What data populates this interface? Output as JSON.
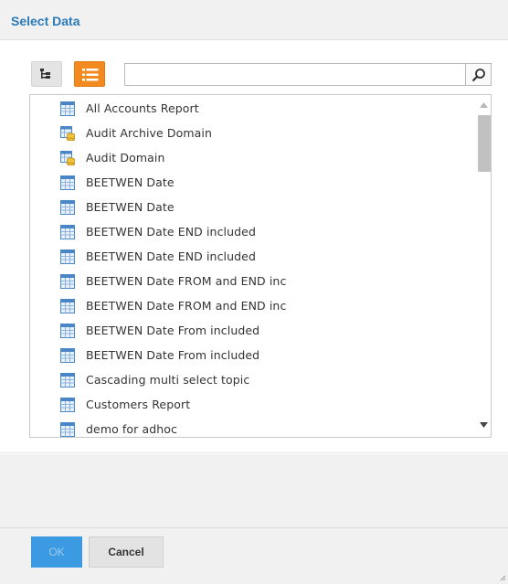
{
  "dialog": {
    "title": "Select Data"
  },
  "toolbar": {
    "tree_view_icon": "tree-view-icon",
    "list_view_icon": "list-view-icon",
    "search_placeholder": "",
    "search_value": "",
    "search_icon": "search-icon"
  },
  "items": [
    {
      "label": "All Accounts Report",
      "icon": "report-icon"
    },
    {
      "label": "Audit Archive Domain",
      "icon": "domain-icon"
    },
    {
      "label": "Audit Domain",
      "icon": "domain-icon"
    },
    {
      "label": "BEETWEN Date",
      "icon": "report-icon"
    },
    {
      "label": "BEETWEN Date",
      "icon": "report-icon"
    },
    {
      "label": "BEETWEN Date END included",
      "icon": "report-icon"
    },
    {
      "label": "BEETWEN Date END included",
      "icon": "report-icon"
    },
    {
      "label": "BEETWEN Date FROM and END inc",
      "icon": "report-icon"
    },
    {
      "label": "BEETWEN Date FROM and END inc",
      "icon": "report-icon"
    },
    {
      "label": "BEETWEN Date From included",
      "icon": "report-icon"
    },
    {
      "label": "BEETWEN Date From included",
      "icon": "report-icon"
    },
    {
      "label": "Cascading multi select topic",
      "icon": "report-icon"
    },
    {
      "label": "Customers Report",
      "icon": "report-icon"
    },
    {
      "label": "demo for adhoc",
      "icon": "report-icon"
    }
  ],
  "footer": {
    "ok_label": "OK",
    "cancel_label": "Cancel"
  },
  "colors": {
    "title": "#2a7ab8",
    "accent_orange": "#f28a1f",
    "ok_blue": "#3b9ae1"
  }
}
